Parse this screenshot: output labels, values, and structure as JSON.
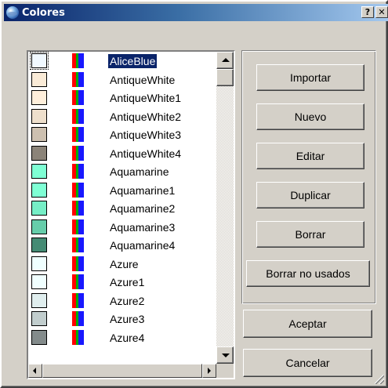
{
  "window": {
    "title": "Colores",
    "help_label": "?",
    "close_label": "✕",
    "icon": "globe-icon"
  },
  "colors": [
    {
      "name": "AliceBlue",
      "hex": "#f0f8ff",
      "selected": true
    },
    {
      "name": "AntiqueWhite",
      "hex": "#faebd7"
    },
    {
      "name": "AntiqueWhite1",
      "hex": "#ffefdb"
    },
    {
      "name": "AntiqueWhite2",
      "hex": "#eedfcc"
    },
    {
      "name": "AntiqueWhite3",
      "hex": "#cdc0b0"
    },
    {
      "name": "AntiqueWhite4",
      "hex": "#8b8378"
    },
    {
      "name": "Aquamarine",
      "hex": "#7fffd4"
    },
    {
      "name": "Aquamarine1",
      "hex": "#7fffd4"
    },
    {
      "name": "Aquamarine2",
      "hex": "#76eec6"
    },
    {
      "name": "Aquamarine3",
      "hex": "#66cdaa"
    },
    {
      "name": "Aquamarine4",
      "hex": "#458b74"
    },
    {
      "name": "Azure",
      "hex": "#f0ffff"
    },
    {
      "name": "Azure1",
      "hex": "#f0ffff"
    },
    {
      "name": "Azure2",
      "hex": "#e0eeee"
    },
    {
      "name": "Azure3",
      "hex": "#c1cdcd"
    },
    {
      "name": "Azure4",
      "hex": "#838b8b"
    }
  ],
  "buttons": {
    "importar": "Importar",
    "nuevo": "Nuevo",
    "editar": "Editar",
    "duplicar": "Duplicar",
    "borrar": "Borrar",
    "borrar_no_usados": "Borrar no usados",
    "aceptar": "Aceptar",
    "cancelar": "Cancelar"
  },
  "theme": {
    "selection": "#0a246a",
    "face": "#d4d0c8",
    "title_start": "#0a246a",
    "title_end": "#a6caf0"
  }
}
